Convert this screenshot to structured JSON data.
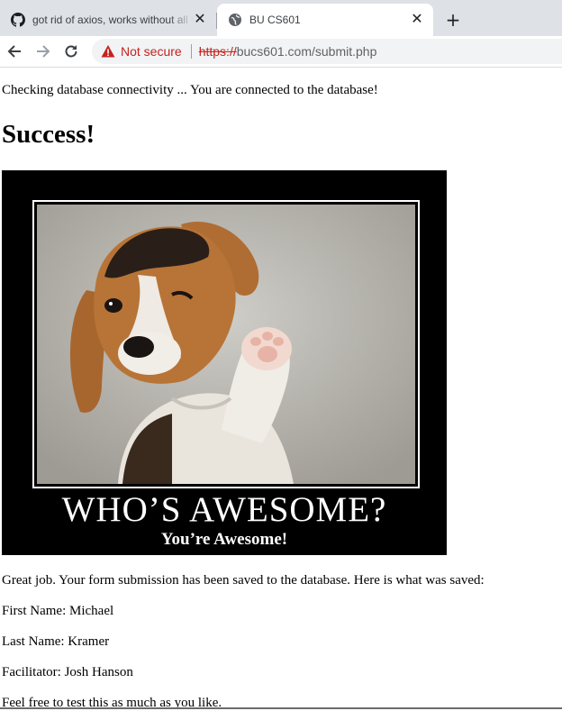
{
  "tabs": [
    {
      "title": "got rid of axios, works without all that",
      "icon": "github-icon",
      "active": false
    },
    {
      "title": "BU CS601",
      "icon": "globe-icon",
      "active": true
    }
  ],
  "toolbar": {
    "security_label": "Not secure",
    "url_scheme": "https://",
    "url_rest": "bucs601.com/submit.php"
  },
  "page": {
    "db_status": "Checking database connectivity ... You are connected to the database!",
    "heading": "Success!",
    "poster": {
      "title": "WHO’S AWESOME?",
      "subtitle": "You’re Awesome!"
    },
    "saved_intro": "Great job. Your form submission has been saved to the database. Here is what was saved:",
    "first_name": "First Name: Michael",
    "last_name": "Last Name: Kramer",
    "facilitator": "Facilitator: Josh Hanson",
    "closing": "Feel free to test this as much as you like."
  },
  "colors": {
    "tabstrip": "#dee1e6",
    "not_secure": "#c5221f",
    "url_text": "#5f6368"
  }
}
